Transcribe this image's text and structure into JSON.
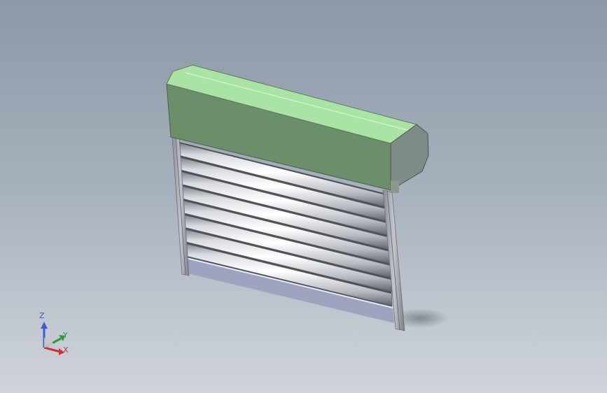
{
  "model": {
    "name": "roller-shutter",
    "slat_count": 8,
    "colors": {
      "housing_front": "#6b8e6b",
      "housing_top": "#a9e4a4",
      "housing_end": "#7f8c86",
      "guide_rail": "#a3a6ae",
      "slat_dark": "#8a8e96",
      "slat_light": "#ffffff",
      "bottom_bar": "#9ea4c0",
      "viewport_top": "#8c98a8",
      "viewport_bottom": "#cfd4da"
    }
  },
  "triad": {
    "z_label": "Z",
    "y_label": "Y",
    "x_label": "X",
    "z_color": "#3b5bd6",
    "y_color": "#2f9a3a",
    "x_color": "#d03030"
  }
}
